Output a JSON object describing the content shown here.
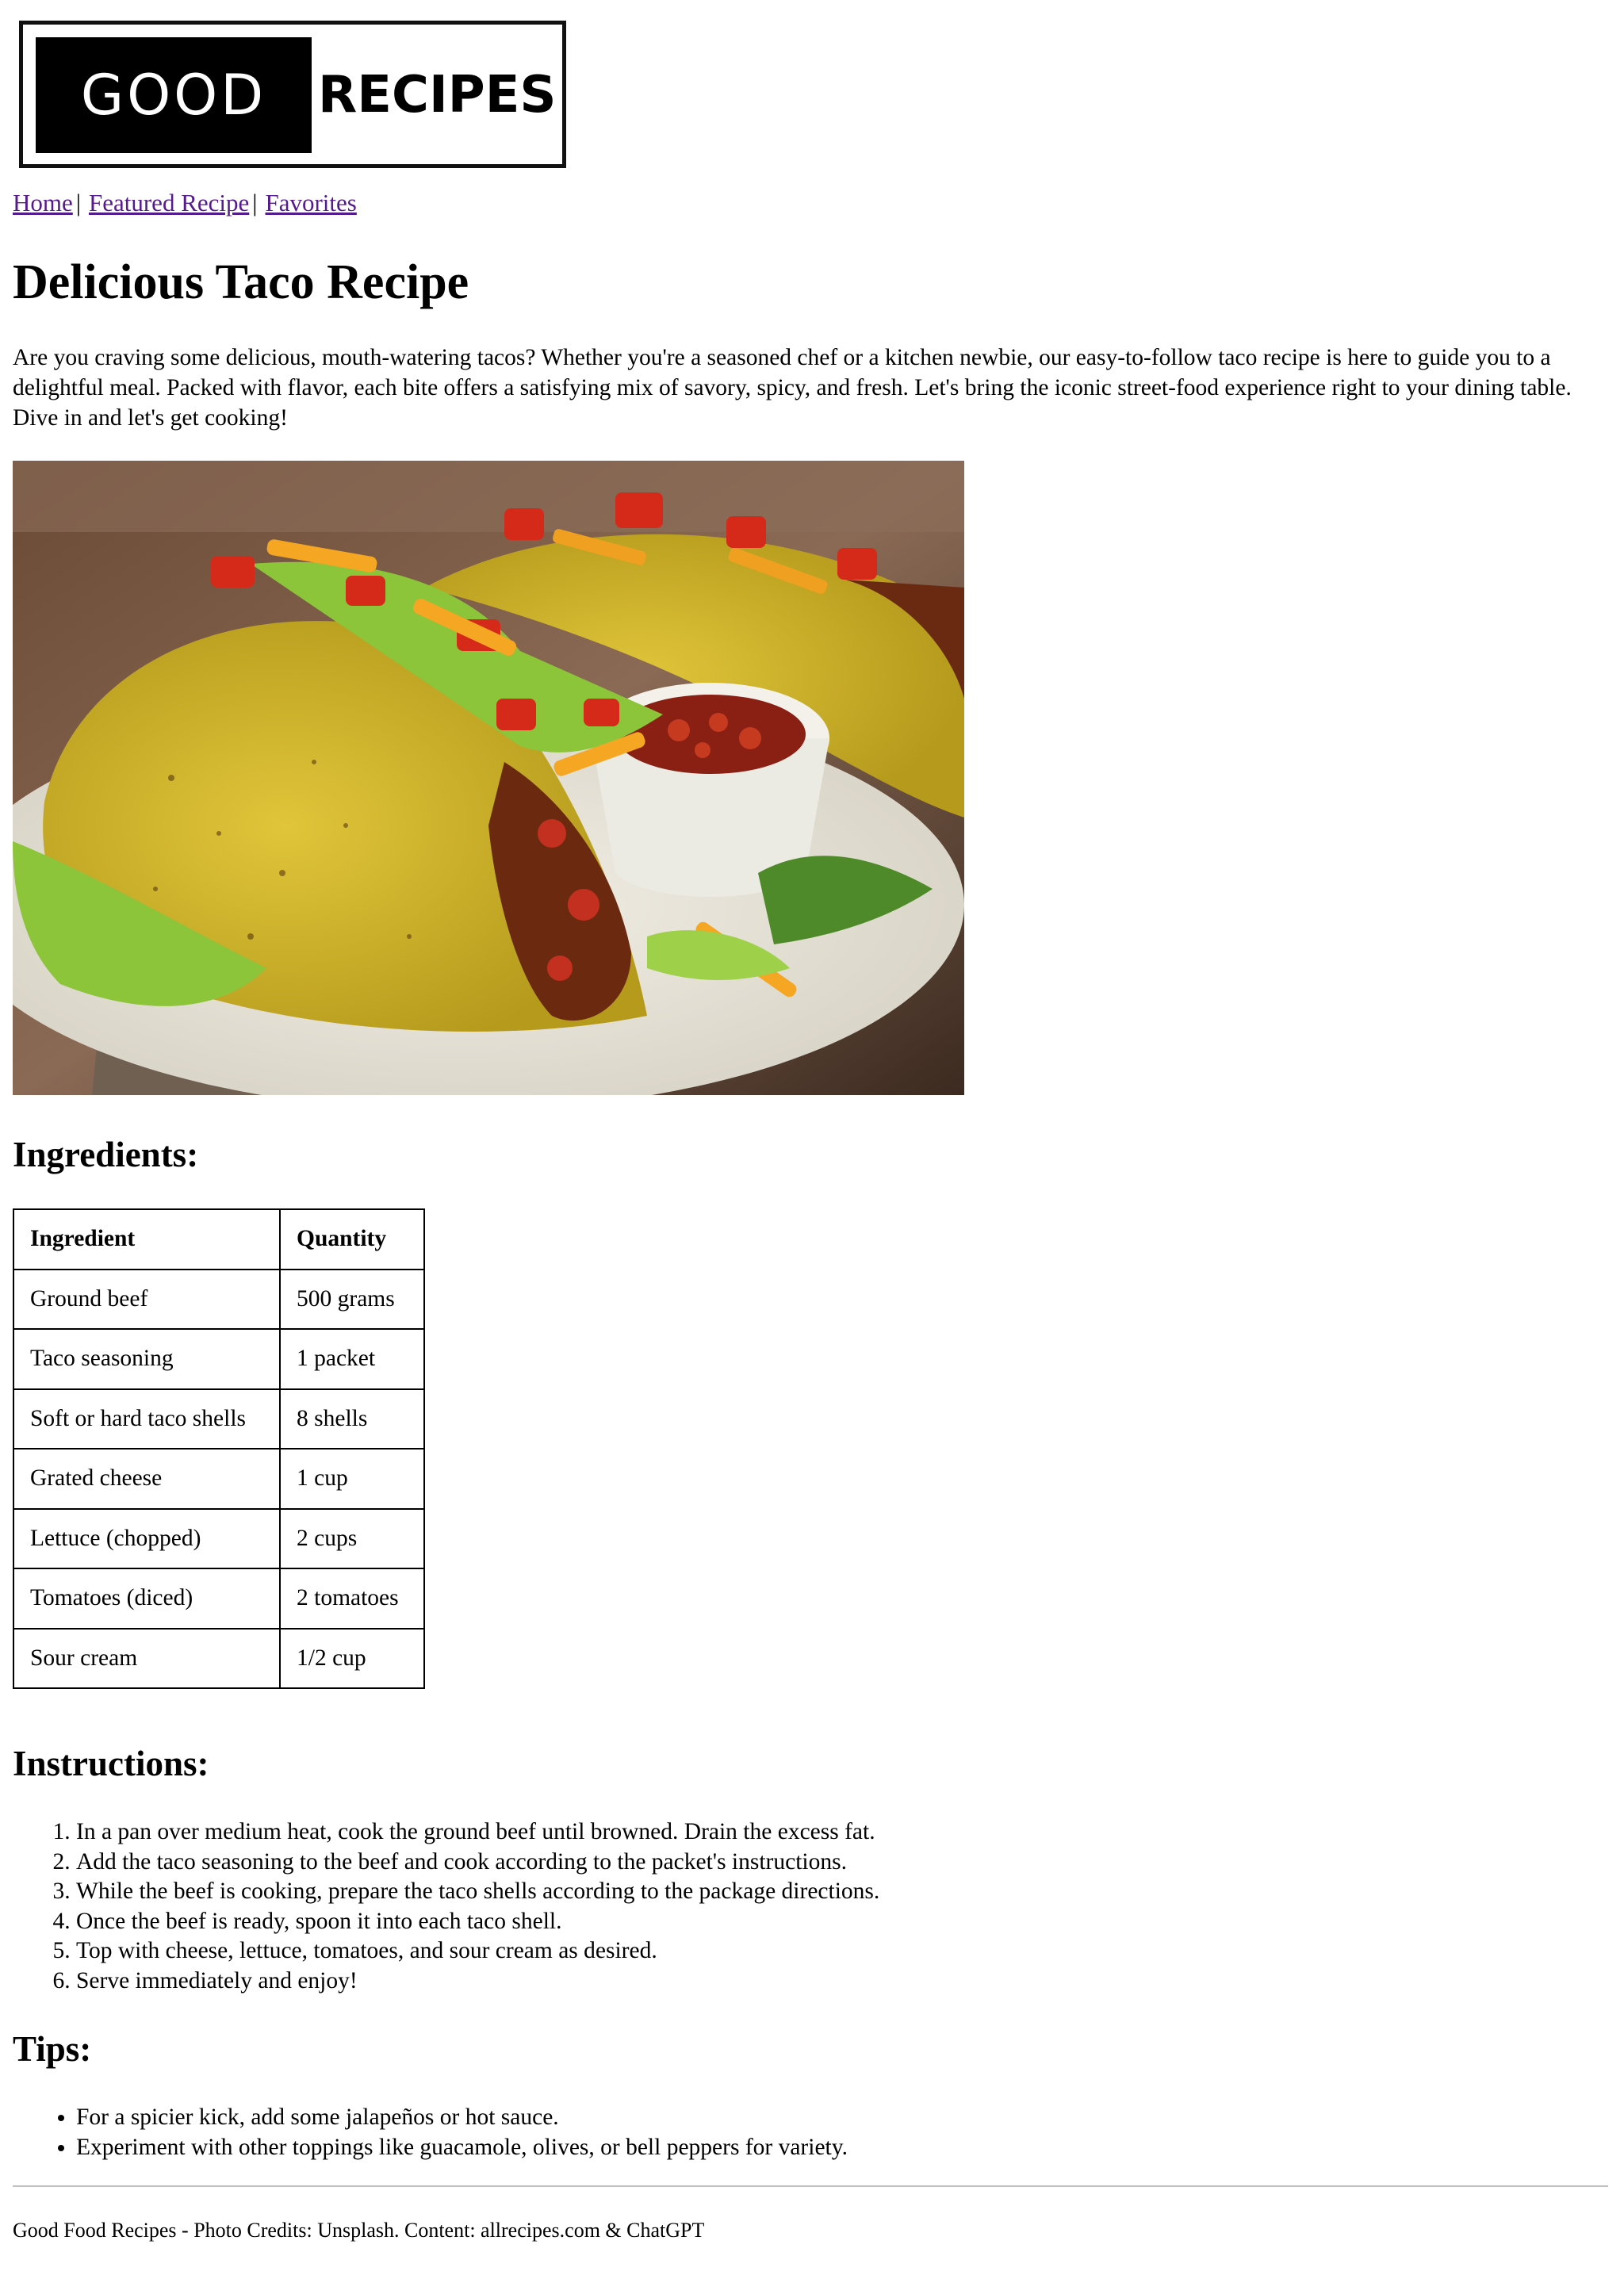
{
  "logo": {
    "part1": "GOOD",
    "part2": "RECIPES"
  },
  "nav": {
    "items": [
      "Home",
      "Featured Recipe",
      "Favorites"
    ],
    "separator": "|"
  },
  "page_title": "Delicious Taco Recipe",
  "intro": "Are you craving some delicious, mouth-watering tacos? Whether you're a seasoned chef or a kitchen newbie, our easy-to-follow taco recipe is here to guide you to a delightful meal. Packed with flavor, each bite offers a satisfying mix of savory, spicy, and fresh. Let's bring the iconic street-food experience right to your dining table. Dive in and let's get cooking!",
  "ingredients": {
    "heading": "Ingredients:",
    "columns": [
      "Ingredient",
      "Quantity"
    ],
    "rows": [
      [
        "Ground beef",
        "500 grams"
      ],
      [
        "Taco seasoning",
        "1 packet"
      ],
      [
        "Soft or hard taco shells",
        "8 shells"
      ],
      [
        "Grated cheese",
        "1 cup"
      ],
      [
        "Lettuce (chopped)",
        "2 cups"
      ],
      [
        "Tomatoes (diced)",
        "2 tomatoes"
      ],
      [
        "Sour cream",
        "1/2 cup"
      ]
    ]
  },
  "instructions": {
    "heading": "Instructions:",
    "steps": [
      "In a pan over medium heat, cook the ground beef until browned. Drain the excess fat.",
      "Add the taco seasoning to the beef and cook according to the packet's instructions.",
      "While the beef is cooking, prepare the taco shells according to the package directions.",
      "Once the beef is ready, spoon it into each taco shell.",
      "Top with cheese, lettuce, tomatoes, and sour cream as desired.",
      "Serve immediately and enjoy!"
    ]
  },
  "tips": {
    "heading": "Tips:",
    "items": [
      "For a spicier kick, add some jalapeños or hot sauce.",
      "Experiment with other toppings like guacamole, olives, or bell peppers for variety."
    ]
  },
  "footer": "Good Food Recipes - Photo Credits: Unsplash. Content: allrecipes.com & ChatGPT",
  "colors": {
    "link_visited": "#551a8b",
    "text": "#000000",
    "rule": "#c0c0c0"
  }
}
